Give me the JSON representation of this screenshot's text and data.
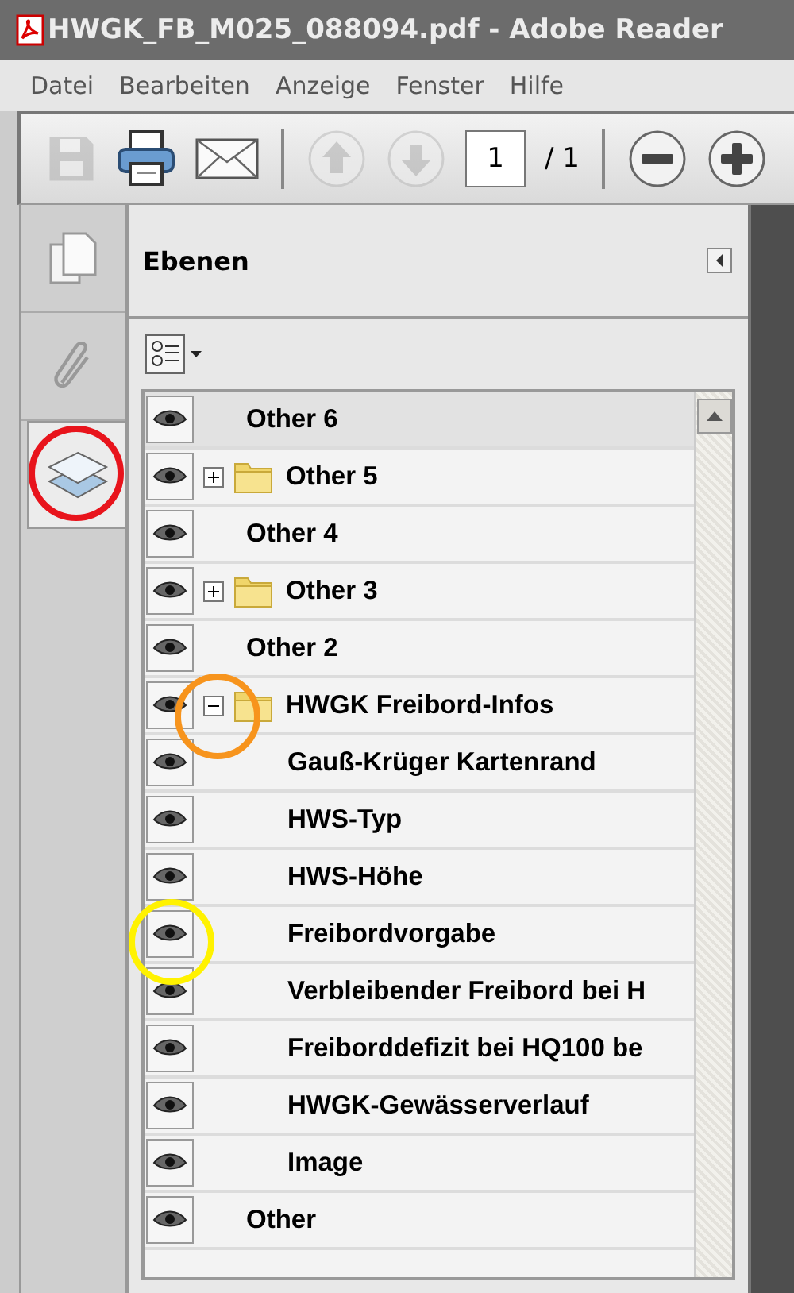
{
  "window": {
    "title": "HWGK_FB_M025_088094.pdf - Adobe Reader"
  },
  "menu": [
    "Datei",
    "Bearbeiten",
    "Anzeige",
    "Fenster",
    "Hilfe"
  ],
  "toolbar": {
    "items": [
      {
        "kind": "save",
        "disabled": true
      },
      {
        "kind": "print",
        "disabled": false
      },
      {
        "kind": "mail",
        "disabled": false
      },
      {
        "kind": "separator"
      },
      {
        "kind": "up",
        "disabled": true
      },
      {
        "kind": "down",
        "disabled": true
      }
    ],
    "page": "1",
    "page_total": "/ 1",
    "zoom_items": [
      {
        "kind": "zoom-out",
        "disabled": false
      },
      {
        "kind": "zoom-in",
        "disabled": false
      }
    ]
  },
  "side_tabs": [
    {
      "kind": "pages",
      "selected": false
    },
    {
      "kind": "attachments",
      "selected": false
    },
    {
      "kind": "layers",
      "selected": true,
      "annotation": {
        "color": "#e8141c"
      }
    }
  ],
  "panel": {
    "title": "Ebenen",
    "layers": [
      {
        "label": "Other 6",
        "visible": true,
        "selected": true,
        "folder": false
      },
      {
        "label": "Other 5",
        "visible": true,
        "selected": false,
        "folder": true,
        "expanded": false
      },
      {
        "label": "Other 4",
        "visible": true,
        "selected": false,
        "folder": false
      },
      {
        "label": "Other 3",
        "visible": true,
        "selected": false,
        "folder": true,
        "expanded": false
      },
      {
        "label": "Other 2",
        "visible": true,
        "selected": false,
        "folder": false
      },
      {
        "label": "HWGK Freibord-Infos",
        "visible": true,
        "selected": false,
        "folder": true,
        "expanded": true,
        "annotation": {
          "color": "#f7941d"
        },
        "children": [
          {
            "label": "Gauß-Krüger Kartenrand",
            "visible": true,
            "selected": false,
            "folder": false
          },
          {
            "label": "HWS-Typ",
            "visible": true,
            "selected": false,
            "folder": false
          },
          {
            "label": "HWS-Höhe",
            "visible": true,
            "selected": false,
            "folder": false
          },
          {
            "label": "Freibordvorgabe",
            "visible": true,
            "selected": false,
            "folder": false,
            "annotation": {
              "color": "#fff200"
            }
          },
          {
            "label": "Verbleibender Freibord bei H",
            "visible": true,
            "selected": false,
            "folder": false
          },
          {
            "label": "Freiborddefizit bei HQ100 be",
            "visible": true,
            "selected": false,
            "folder": false
          },
          {
            "label": "HWGK-Gewässerverlauf",
            "visible": true,
            "selected": false,
            "folder": false
          },
          {
            "label": "Image",
            "visible": true,
            "selected": false,
            "folder": false
          }
        ]
      },
      {
        "label": "Other",
        "visible": true,
        "selected": false,
        "folder": false
      }
    ]
  }
}
